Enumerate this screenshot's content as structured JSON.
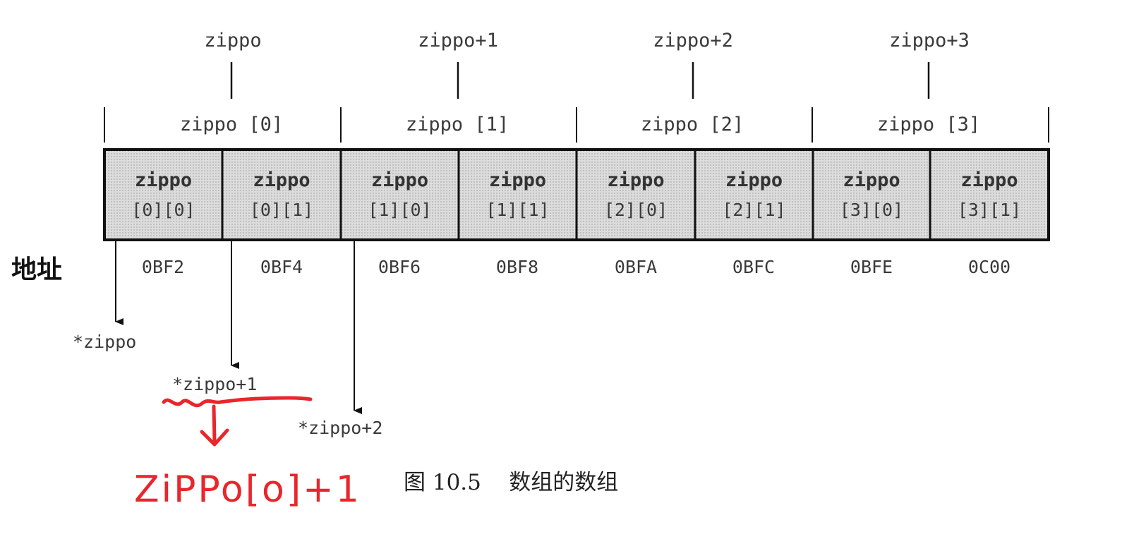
{
  "top_labels": [
    "zippo",
    "zippo+1",
    "zippo+2",
    "zippo+3"
  ],
  "group_labels": [
    "zippo [0]",
    "zippo [1]",
    "zippo [2]",
    "zippo [3]"
  ],
  "cells": [
    {
      "name": "zippo",
      "index": "[0][0]"
    },
    {
      "name": "zippo",
      "index": "[0][1]"
    },
    {
      "name": "zippo",
      "index": "[1][0]"
    },
    {
      "name": "zippo",
      "index": "[1][1]"
    },
    {
      "name": "zippo",
      "index": "[2][0]"
    },
    {
      "name": "zippo",
      "index": "[2][1]"
    },
    {
      "name": "zippo",
      "index": "[3][0]"
    },
    {
      "name": "zippo",
      "index": "[3][1]"
    }
  ],
  "address_title": "地址",
  "addresses": [
    "0BF2",
    "0BF4",
    "0BF6",
    "0BF8",
    "0BFA",
    "0BFC",
    "0BFE",
    "0C00"
  ],
  "deref_labels": [
    "*zippo",
    "*zippo+1",
    "*zippo+2"
  ],
  "caption": "图 10.5    数组的数组",
  "handwritten_note": "ZiPPo[o]+1",
  "colors": {
    "annotation": "#e8262b",
    "cell_fill": "#dcdcdc",
    "line": "#111111"
  }
}
